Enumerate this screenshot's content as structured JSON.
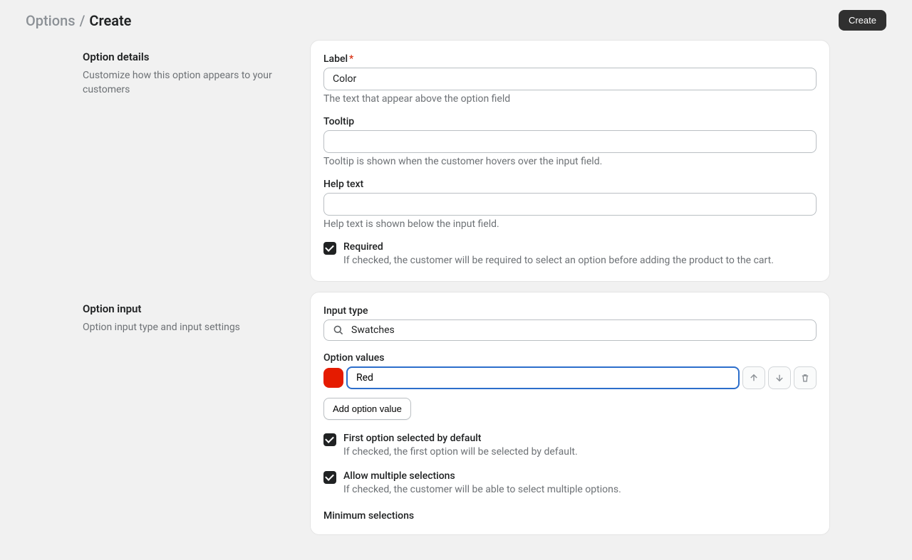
{
  "header": {
    "breadcrumb_parent": "Options",
    "breadcrumb_sep": "/",
    "breadcrumb_current": "Create",
    "create_button": "Create"
  },
  "details": {
    "section_title": "Option details",
    "section_desc": "Customize how this option appears to your customers",
    "label": {
      "label": "Label",
      "value": "Color",
      "help": "The text that appear above the option field"
    },
    "tooltip": {
      "label": "Tooltip",
      "value": "",
      "help": "Tooltip is shown when the customer hovers over the input field."
    },
    "helptext": {
      "label": "Help text",
      "value": "",
      "help": "Help text is shown below the input field."
    },
    "required": {
      "title": "Required",
      "desc": "If checked, the customer will be required to select an option before adding the product to the cart."
    }
  },
  "input": {
    "section_title": "Option input",
    "section_desc": "Option input type and input settings",
    "type_label": "Input type",
    "type_value": "Swatches",
    "values_label": "Option values",
    "values": [
      {
        "name": "Red",
        "color": "#e51b00"
      }
    ],
    "add_value": "Add option value",
    "first_selected": {
      "title": "First option selected by default",
      "desc": "If checked, the first option will be selected by default."
    },
    "allow_multiple": {
      "title": "Allow multiple selections",
      "desc": "If checked, the customer will be able to select multiple options."
    },
    "min_label": "Minimum selections"
  }
}
